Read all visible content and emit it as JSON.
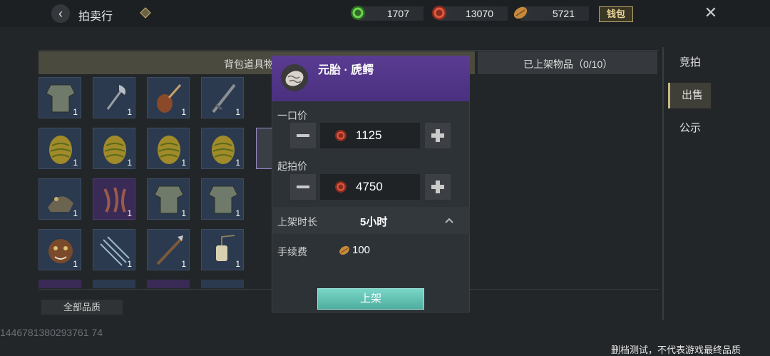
{
  "header": {
    "title": "拍卖行",
    "currencies": [
      {
        "name": "jade",
        "value": "1707",
        "color": "#4caf3a"
      },
      {
        "name": "spirit",
        "value": "13070",
        "color": "#c43f2c"
      },
      {
        "name": "seed",
        "value": "5721",
        "color": "#c78a3a"
      }
    ],
    "wallet_label": "钱包"
  },
  "tabs_header": {
    "bag": "背包道具物",
    "listed": "已上架物品（0/10）"
  },
  "side_tabs": [
    "竞拍",
    "出售",
    "公示"
  ],
  "active_side_tab": "出售",
  "bag_items": [
    {
      "count": "1",
      "icon": "armor-icon",
      "purple": false
    },
    {
      "count": "1",
      "icon": "axe-icon",
      "purple": false
    },
    {
      "count": "1",
      "icon": "pipa-icon",
      "purple": false
    },
    {
      "count": "1",
      "icon": "sword-icon",
      "purple": false
    },
    {
      "count": "1",
      "icon": "egg-icon",
      "purple": false
    },
    {
      "count": "1",
      "icon": "egg-icon",
      "purple": false
    },
    {
      "count": "1",
      "icon": "egg-icon",
      "purple": false
    },
    {
      "count": "1",
      "icon": "egg-icon",
      "purple": false
    },
    {
      "count": "1",
      "icon": "beast-icon",
      "purple": false
    },
    {
      "count": "1",
      "icon": "claw-icon",
      "purple": true
    },
    {
      "count": "1",
      "icon": "armor-icon",
      "purple": false
    },
    {
      "count": "1",
      "icon": "armor-icon",
      "purple": false
    },
    {
      "count": "1",
      "icon": "beast-head-icon",
      "purple": false
    },
    {
      "count": "1",
      "icon": "arrows-icon",
      "purple": false
    },
    {
      "count": "1",
      "icon": "spear-icon",
      "purple": false
    },
    {
      "count": "1",
      "icon": "lantern-icon",
      "purple": false
    }
  ],
  "all_quality": "全部品质",
  "popup": {
    "item_name": "元胎 · 虒鳄",
    "buyout_label": "一口价",
    "buyout_value": "1125",
    "start_label": "起拍价",
    "start_value": "4750",
    "duration_label": "上架时长",
    "duration_value": "5小时",
    "fee_label": "手续费",
    "fee_value": "100",
    "confirm": "上架"
  },
  "footer_id": "1446781380293761 74",
  "disclaimer": "删档测试，不代表游戏最终品质"
}
